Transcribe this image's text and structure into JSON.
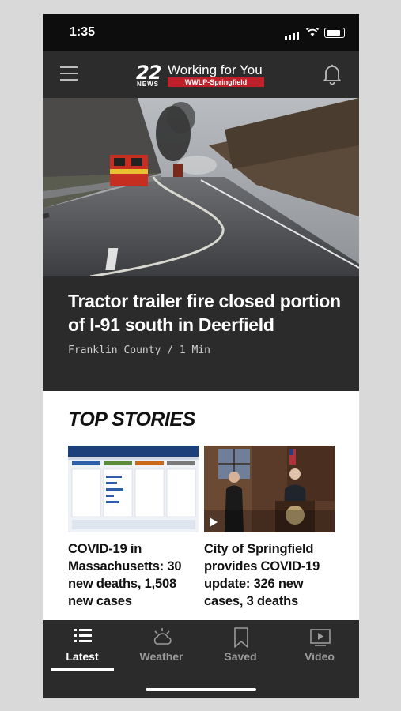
{
  "status_bar": {
    "time": "1:35"
  },
  "header": {
    "logo_number": "22",
    "logo_news": "NEWS",
    "logo_tagline": "Working for You",
    "logo_station": "WWLP-Springfield",
    "brand_color": "#c0202a"
  },
  "hero": {
    "headline": "Tractor trailer fire closed portion of I-91 south in Deerfield",
    "meta": "Franklin County / 1 Min"
  },
  "top_stories": {
    "title": "TOP STORIES",
    "items": [
      {
        "title": "COVID-19 in Massachusetts: 30 new deaths, 1,508 new cases",
        "thumb": "dashboard-screenshot"
      },
      {
        "title": "City of Springfield provides COVID-19 update: 326 new cases, 3 deaths",
        "thumb": "press-conference-video"
      }
    ]
  },
  "tabs": [
    {
      "label": "Latest",
      "icon": "list-icon",
      "active": true
    },
    {
      "label": "Weather",
      "icon": "weather-icon",
      "active": false
    },
    {
      "label": "Saved",
      "icon": "bookmark-icon",
      "active": false
    },
    {
      "label": "Video",
      "icon": "video-icon",
      "active": false
    }
  ]
}
